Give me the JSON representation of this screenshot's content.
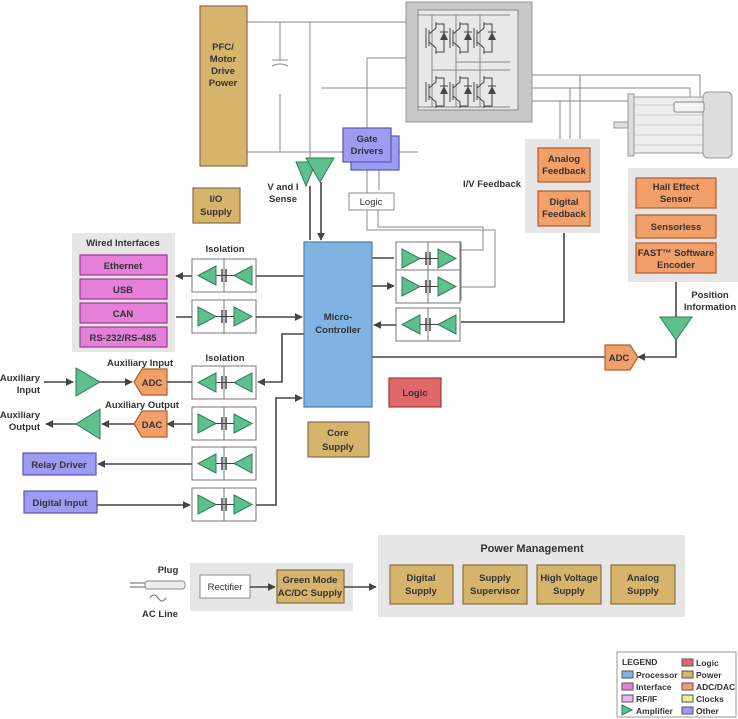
{
  "power_stage": {
    "pfc": [
      "PFC/",
      "Motor",
      "Drive",
      "Power"
    ]
  },
  "gate_drivers": [
    "Gate",
    "Drivers"
  ],
  "v_i_sense": [
    "V and I",
    "Sense"
  ],
  "logic_small": "Logic",
  "io_supply": [
    "I/O",
    "Supply"
  ],
  "iv_feedback": "I/V Feedback",
  "feedback": {
    "analog": [
      "Analog",
      "Feedback"
    ],
    "digital": [
      "Digital",
      "Feedback"
    ]
  },
  "position": {
    "hall": [
      "Hall Effect",
      "Sensor"
    ],
    "sensorless": "Sensorless",
    "fast": [
      "FAST™ Software",
      "Encoder"
    ],
    "label": [
      "Position",
      "Information"
    ],
    "adc": "ADC"
  },
  "wired_interfaces": {
    "title": "Wired Interfaces",
    "items": [
      "Ethernet",
      "USB",
      "CAN",
      "RS-232/RS-485"
    ]
  },
  "isolation_label": "Isolation",
  "microcontroller": [
    "Micro-",
    "Controller"
  ],
  "logic": "Logic",
  "core_supply": [
    "Core",
    "Supply"
  ],
  "aux_input": {
    "label": [
      "Auxiliary",
      "Input"
    ],
    "title": "Auxiliary Input",
    "adc": "ADC"
  },
  "aux_output": {
    "label": [
      "Auxiliary",
      "Output"
    ],
    "title": "Auxiliary Output",
    "dac": "DAC"
  },
  "relay_driver": "Relay Driver",
  "digital_input": "Digital Input",
  "ac": {
    "plug": "Plug",
    "line": "AC Line",
    "rectifier": "Rectifier",
    "green_mode": [
      "Green Mode",
      "AC/DC Supply"
    ]
  },
  "power_management": {
    "title": "Power Management",
    "items": [
      [
        "Digital",
        "Supply"
      ],
      [
        "Supply",
        "Supervisor"
      ],
      [
        "High Voltage",
        "Supply"
      ],
      [
        "Analog",
        "Supply"
      ]
    ]
  },
  "legend": {
    "title": "LEGEND",
    "items": [
      {
        "label": "Processor",
        "color": "#7fb3e2"
      },
      {
        "label": "Interface",
        "color": "#e57fd8"
      },
      {
        "label": "RF/IF",
        "color": "#f0b0ea"
      },
      {
        "label": "Amplifier",
        "color": "#5ec08c"
      },
      {
        "label": "Logic",
        "color": "#e06868"
      },
      {
        "label": "Power",
        "color": "#d6b46c"
      },
      {
        "label": "ADC/DAC",
        "color": "#f2a06a"
      },
      {
        "label": "Clocks",
        "color": "#f0ea90"
      },
      {
        "label": "Other",
        "color": "#9e9cf2"
      }
    ]
  }
}
